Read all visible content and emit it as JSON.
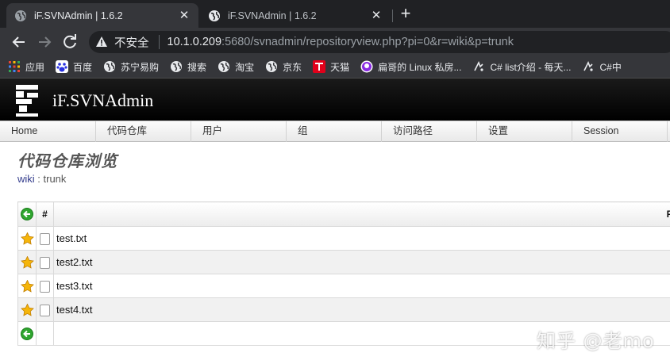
{
  "browser": {
    "tabs": [
      {
        "title": "iF.SVNAdmin | 1.6.2",
        "active": true
      },
      {
        "title": "iF.SVNAdmin | 1.6.2",
        "active": false
      }
    ],
    "new_tab": "+",
    "close_glyph": "✕",
    "address": {
      "security_label": "不安全",
      "host": "10.1.0.209",
      "rest": ":5680/svnadmin/repositoryview.php?pi=0&r=wiki&p=trunk"
    },
    "bookmarks": [
      {
        "label": "应用",
        "icon": "apps-grid-icon"
      },
      {
        "label": "百度",
        "icon": "baidu-paw-icon"
      },
      {
        "label": "苏宁易购",
        "icon": "globe-icon"
      },
      {
        "label": "搜索",
        "icon": "globe-icon"
      },
      {
        "label": "淘宝",
        "icon": "globe-icon"
      },
      {
        "label": "京东",
        "icon": "globe-icon"
      },
      {
        "label": "天猫",
        "icon": "tmall-icon"
      },
      {
        "label": "扁哥的 Linux 私房...",
        "icon": "linux-site-icon"
      },
      {
        "label": "C# list介绍 - 每天...",
        "icon": "cnblogs-icon"
      },
      {
        "label": "C#中",
        "icon": "cnblogs-icon"
      }
    ]
  },
  "app": {
    "title": "iF.SVNAdmin",
    "menu": [
      "Home",
      "代码仓库",
      "用户",
      "组",
      "访问路径",
      "设置",
      "Session"
    ]
  },
  "main": {
    "heading": "代码仓库浏览",
    "breadcrumb": {
      "repo": "wiki",
      "separator": " : ",
      "path": "trunk"
    },
    "table": {
      "header_hash": "#",
      "header_file": "F",
      "rows": [
        {
          "name": "test.txt"
        },
        {
          "name": "test2.txt"
        },
        {
          "name": "test3.txt"
        },
        {
          "name": "test4.txt"
        }
      ]
    }
  },
  "watermark": "知乎 @老mo",
  "colors": {
    "chrome_dark": "#202124",
    "chrome_toolbar": "#35363a",
    "header_black": "#000000",
    "link_blue": "#333c8c",
    "back_green": "#2fa52f",
    "star_gold": "#f5b50a"
  }
}
